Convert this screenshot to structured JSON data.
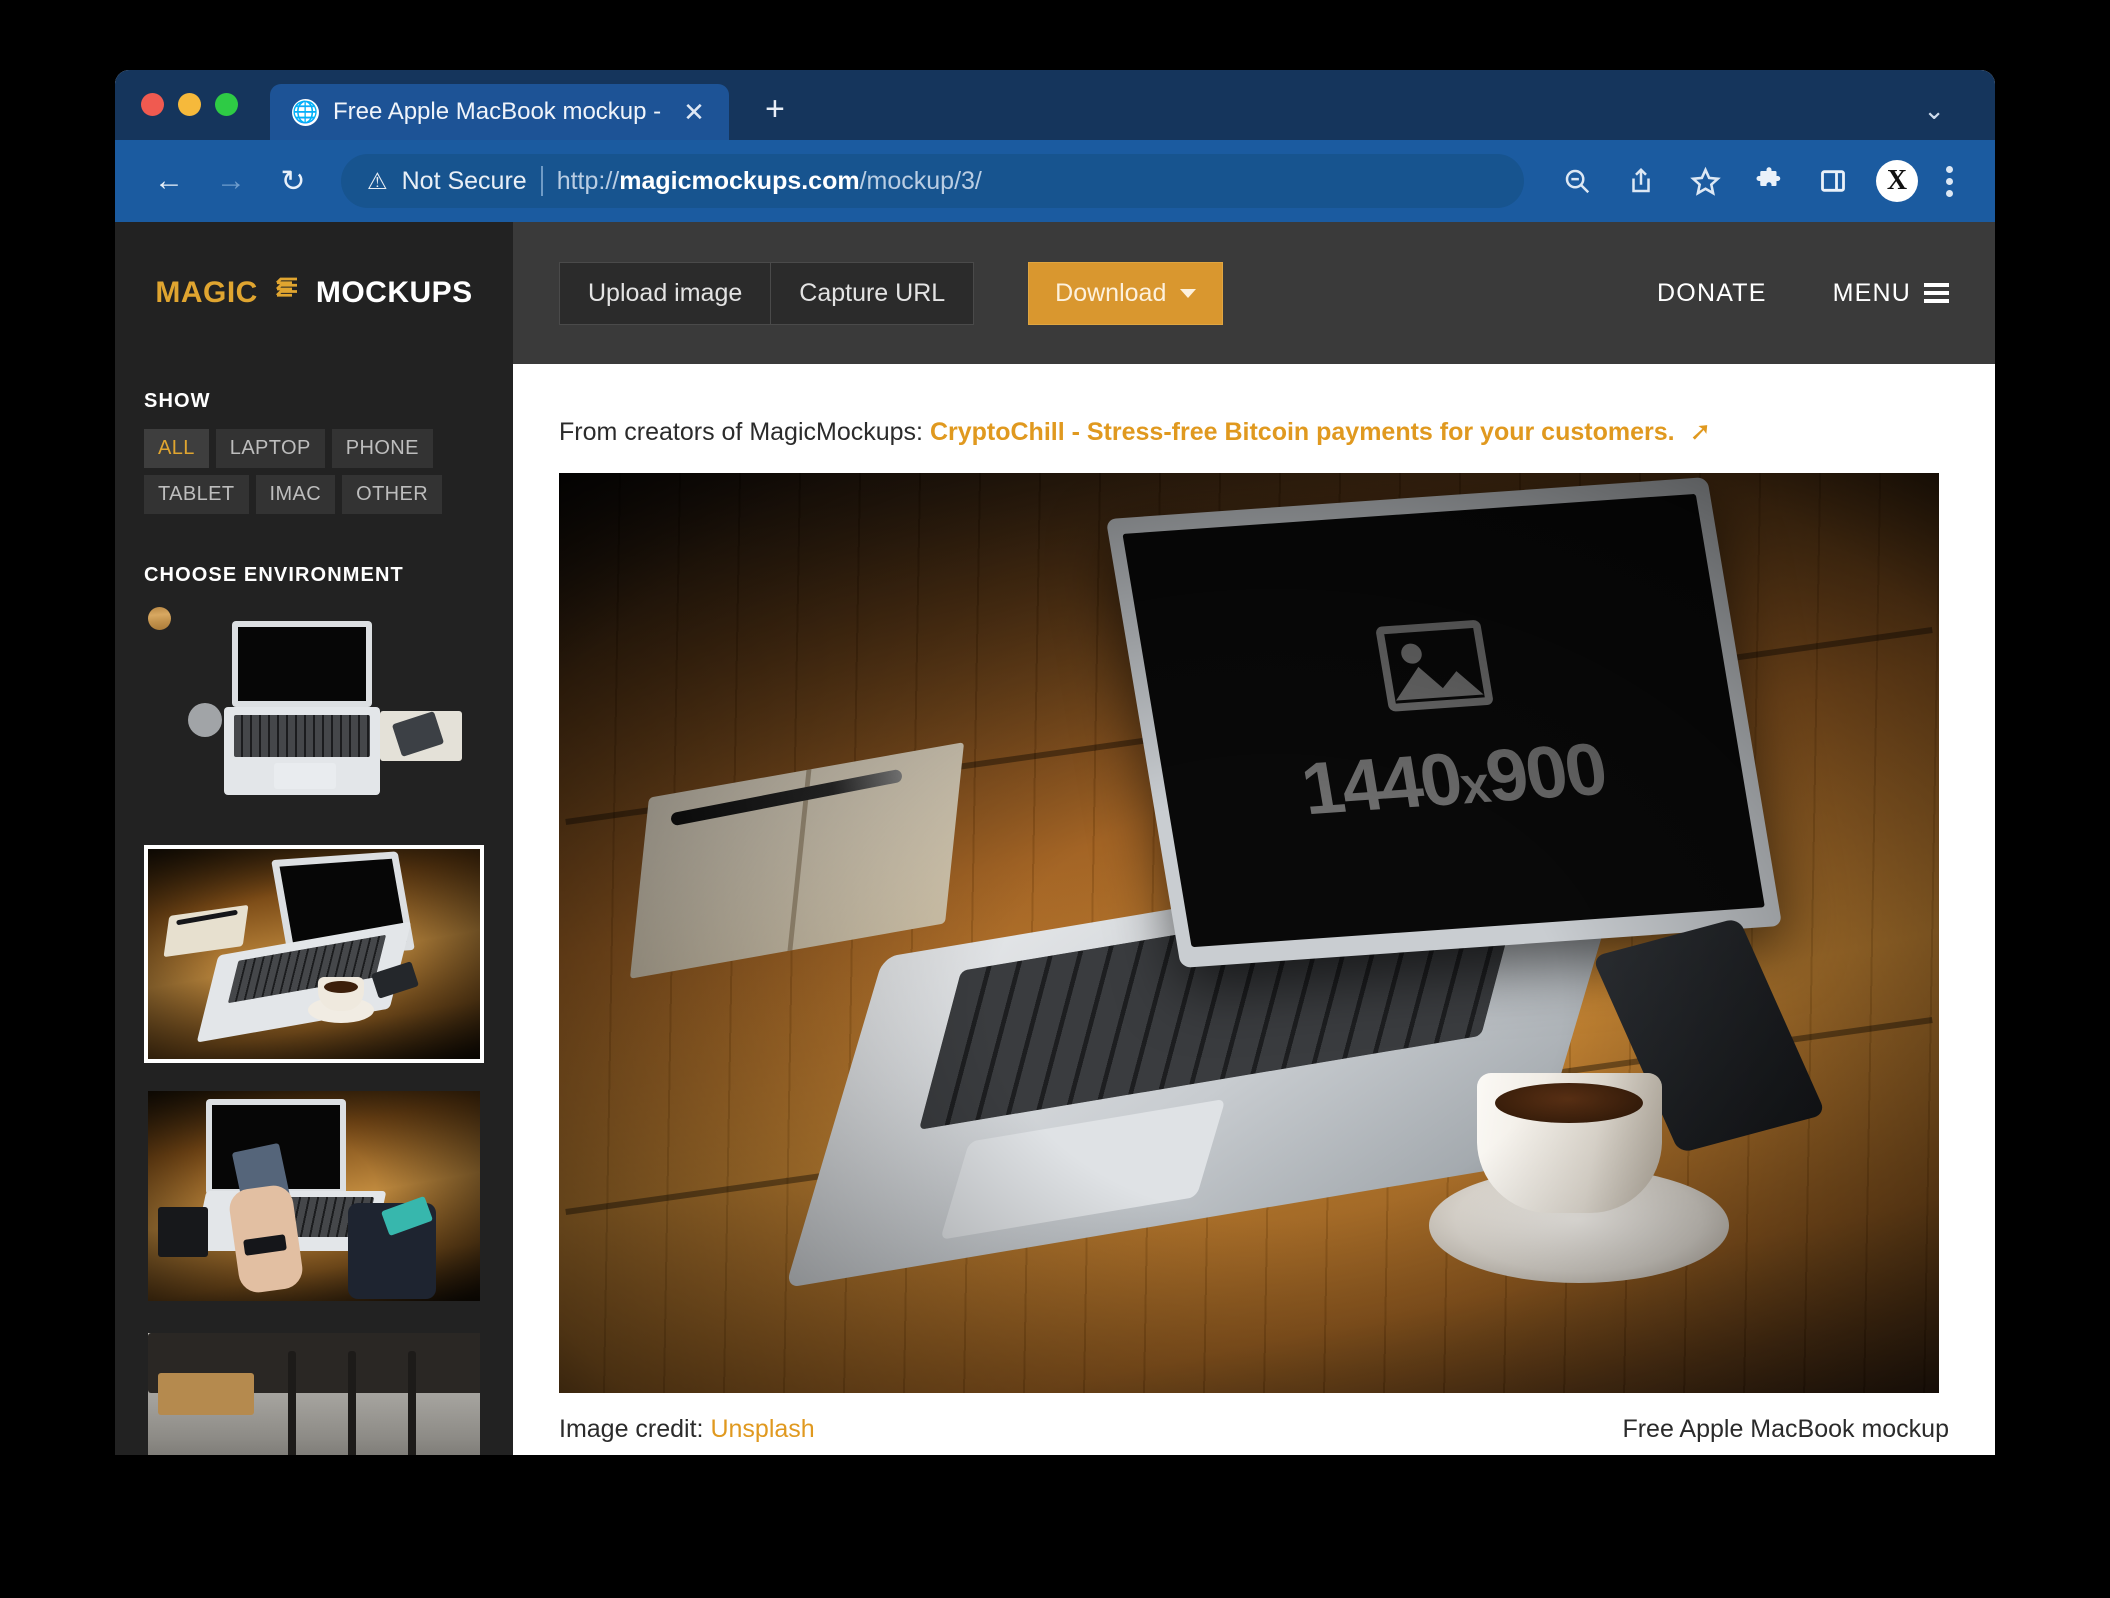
{
  "browser": {
    "tab": {
      "favicon": "globe-icon",
      "title": "Free Apple MacBook mockup -",
      "close_label": "✕"
    },
    "new_tab_label": "+",
    "tab_list_chevron": "⌄",
    "nav": {
      "back": "←",
      "forward": "→",
      "reload": "↻"
    },
    "omnibox": {
      "security_icon": "not-secure-warning-icon",
      "security_label": "Not Secure",
      "url_scheme": "http://",
      "url_host": "magicmockups.com",
      "url_path": "/mockup/3/"
    },
    "toolbar_icons": [
      "zoom-out-icon",
      "share-icon",
      "bookmark-star-icon",
      "extensions-puzzle-icon",
      "side-panel-icon"
    ],
    "profile_initial": "X",
    "menu_label": "⋮"
  },
  "sidebar": {
    "brand": {
      "magic": "MAGIC",
      "icon": "stacked-layers-icon",
      "mockups": "MOCKUPS"
    },
    "show": {
      "heading": "SHOW",
      "chips": [
        {
          "label": "ALL",
          "active": true
        },
        {
          "label": "LAPTOP",
          "active": false
        },
        {
          "label": "PHONE",
          "active": false
        },
        {
          "label": "TABLET",
          "active": false
        },
        {
          "label": "IMAC",
          "active": false
        },
        {
          "label": "OTHER",
          "active": false
        }
      ]
    },
    "environment": {
      "heading": "CHOOSE ENVIRONMENT",
      "thumbnails": [
        {
          "name": "laptop-topdown-wood-desk",
          "selected": false
        },
        {
          "name": "laptop-coffee-dark-desk",
          "selected": true
        },
        {
          "name": "laptop-person-holding-phone",
          "selected": false
        },
        {
          "name": "laptop-cafe-window",
          "selected": false
        }
      ]
    }
  },
  "app_header": {
    "upload_label": "Upload image",
    "capture_label": "Capture URL",
    "download_label": "Download",
    "donate_label": "DONATE",
    "menu_label": "MENU"
  },
  "content": {
    "promo": {
      "prefix": "From creators of MagicMockups:",
      "link": "CryptoChill - Stress-free Bitcoin payments for your customers.",
      "arrow": "➚"
    },
    "mockup": {
      "screen_placeholder_icon": "image-placeholder-icon",
      "screen_resolution_width": "1440",
      "screen_resolution_x": "x",
      "screen_resolution_height": "900"
    },
    "footer": {
      "credit_prefix": "Image credit:",
      "credit_link": "Unsplash",
      "mockup_title": "Free Apple MacBook mockup"
    }
  },
  "colors": {
    "browser_tabstrip": "#15355c",
    "browser_toolbar": "#1b5ba0",
    "sidebar_bg": "#222222",
    "app_header_bg": "#3a3a3a",
    "accent_orange": "#e0a530",
    "download_button": "#d9972f"
  }
}
